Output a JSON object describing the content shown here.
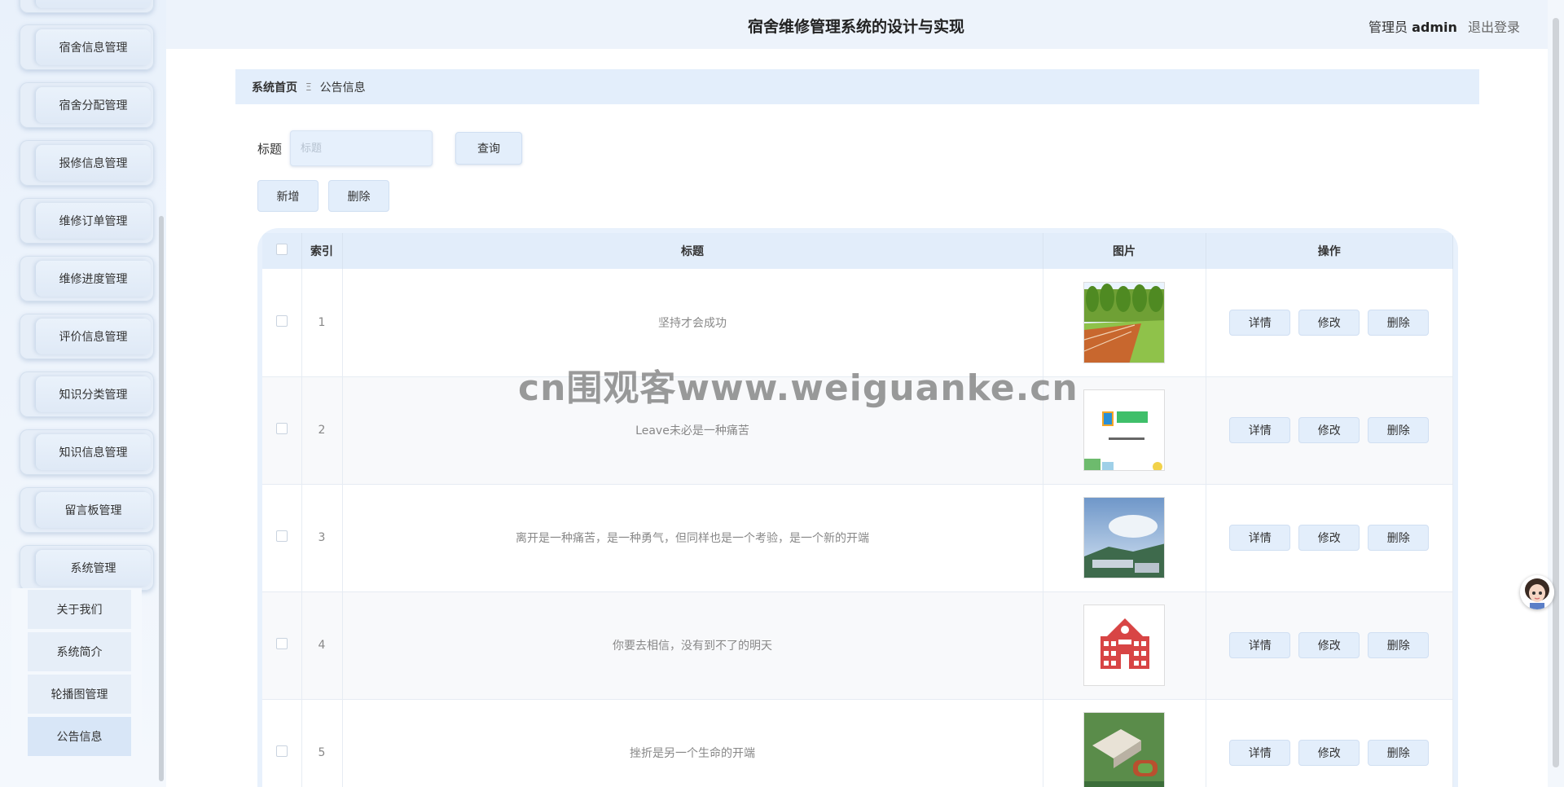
{
  "app": {
    "title": "宿舍维修管理系统的设计与实现",
    "role": "管理员",
    "username": "admin",
    "logout": "退出登录"
  },
  "sidebar": {
    "items": [
      {
        "label": "宿舍信息管理"
      },
      {
        "label": "宿舍分配管理"
      },
      {
        "label": "报修信息管理"
      },
      {
        "label": "维修订单管理"
      },
      {
        "label": "维修进度管理"
      },
      {
        "label": "评价信息管理"
      },
      {
        "label": "知识分类管理"
      },
      {
        "label": "知识信息管理"
      },
      {
        "label": "留言板管理"
      },
      {
        "label": "系统管理"
      }
    ],
    "submenu": [
      {
        "label": "关于我们"
      },
      {
        "label": "系统简介"
      },
      {
        "label": "轮播图管理"
      },
      {
        "label": "公告信息",
        "active": true
      }
    ]
  },
  "breadcrumb": {
    "home": "系统首页",
    "separator": "Ξ",
    "current": "公告信息"
  },
  "search": {
    "label": "标题",
    "placeholder": "标题",
    "value": "",
    "button": "查询"
  },
  "actions": {
    "add": "新增",
    "delete": "删除"
  },
  "table": {
    "headers": {
      "index": "索引",
      "title": "标题",
      "image": "图片",
      "ops": "操作"
    },
    "op_labels": {
      "detail": "详情",
      "edit": "修改",
      "delete": "删除"
    },
    "rows": [
      {
        "index": "1",
        "title": "坚持才会成功",
        "image": "running-track-photo"
      },
      {
        "index": "2",
        "title": "Leave未必是一种痛苦",
        "image": "study-logo-image"
      },
      {
        "index": "3",
        "title": "离开是一种痛苦，是一种勇气，但同样也是一个考验，是一个新的开端",
        "image": "campus-sky-photo"
      },
      {
        "index": "4",
        "title": "你要去相信，没有到不了的明天",
        "image": "school-building-icon"
      },
      {
        "index": "5",
        "title": "挫折是另一个生命的开端",
        "image": "campus-aerial-photo"
      }
    ]
  },
  "watermark": "cn围观客www.weiguanke.cn"
}
